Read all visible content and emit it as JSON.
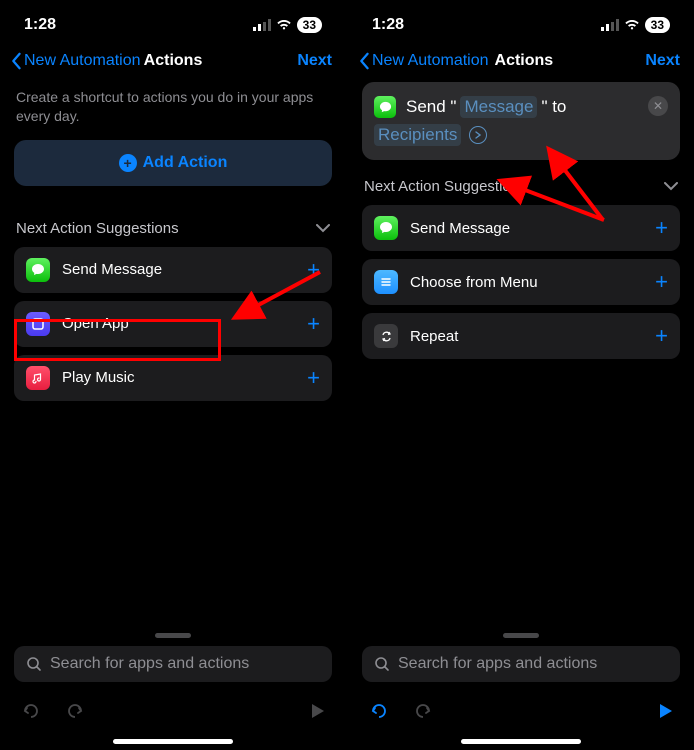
{
  "status": {
    "time": "1:28",
    "battery": "33"
  },
  "nav": {
    "back": "New Automation",
    "title": "Actions",
    "next": "Next"
  },
  "left": {
    "description": "Create a shortcut to actions you do in your apps every day.",
    "add_action": "Add Action",
    "section": "Next Action Suggestions",
    "items": [
      {
        "label": "Send Message"
      },
      {
        "label": "Open App"
      },
      {
        "label": "Play Music"
      }
    ],
    "search_placeholder": "Search for apps and actions"
  },
  "right": {
    "card": {
      "prefix": "Send \"",
      "param1": "Message",
      "mid": "\" to",
      "param2": "Recipients"
    },
    "section": "Next Action Suggestions",
    "items": [
      {
        "label": "Send Message"
      },
      {
        "label": "Choose from Menu"
      },
      {
        "label": "Repeat"
      }
    ],
    "search_placeholder": "Search for apps and actions"
  }
}
